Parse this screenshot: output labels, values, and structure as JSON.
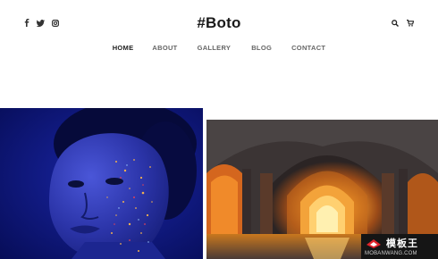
{
  "header": {
    "brand": "#Boto",
    "social": [
      "facebook-icon",
      "twitter-icon",
      "instagram-icon"
    ],
    "tools": [
      "search-icon",
      "cart-icon"
    ]
  },
  "nav": {
    "items": [
      {
        "label": "HOME",
        "active": true
      },
      {
        "label": "ABOUT",
        "active": false
      },
      {
        "label": "GALLERY",
        "active": false
      },
      {
        "label": "BLOG",
        "active": false
      },
      {
        "label": "CONTACT",
        "active": false
      }
    ]
  },
  "gallery": {
    "images": [
      {
        "subject": "portrait of woman with glitter face paint, blue tone"
      },
      {
        "subject": "illuminated arched vaulted corridor with reflecting water"
      }
    ]
  },
  "watermark": {
    "title": "模板王",
    "url": "MOBANWANG.COM"
  },
  "colors": {
    "text": "#1a1a1a",
    "nav": "#666666",
    "active_underline": "#c6b34d",
    "left_photo_bg": "#0b1572",
    "watermark_bg": "#151515",
    "watermark_accent": "#e0232b"
  }
}
